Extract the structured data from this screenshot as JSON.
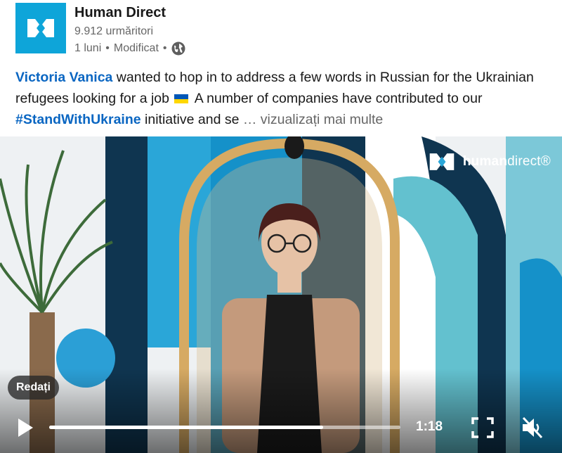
{
  "header": {
    "org_name": "Human Direct",
    "followers": "9.912 urmăritori",
    "time_ago": "1 luni",
    "separator": "•",
    "edited": "Modificat",
    "logo_icon": "human-direct-logo-icon",
    "visibility_icon": "globe-icon"
  },
  "post": {
    "mention": "Victoria Vanica",
    "text_1": " wanted to hop in to address a few words in Russian for the Ukrainian refugees looking for a job",
    "text_2": " A number of companies have contributed to our ",
    "hashtag": "#StandWithUkraine",
    "text_3": " initiative and se",
    "see_more": " … vizualizați mai multe"
  },
  "video": {
    "brand_bold": "human",
    "brand_light": "direct",
    "brand_reg": "®",
    "replay_label": "Redați",
    "duration": "1:18",
    "progress": 0.78,
    "controls": {
      "play_icon": "play-icon",
      "fullscreen_icon": "fullscreen-icon",
      "mute_icon": "volume-muted-icon"
    }
  },
  "colors": {
    "brand": "#0ea5d9",
    "link": "#0a66c2",
    "muted_text": "#666666"
  }
}
